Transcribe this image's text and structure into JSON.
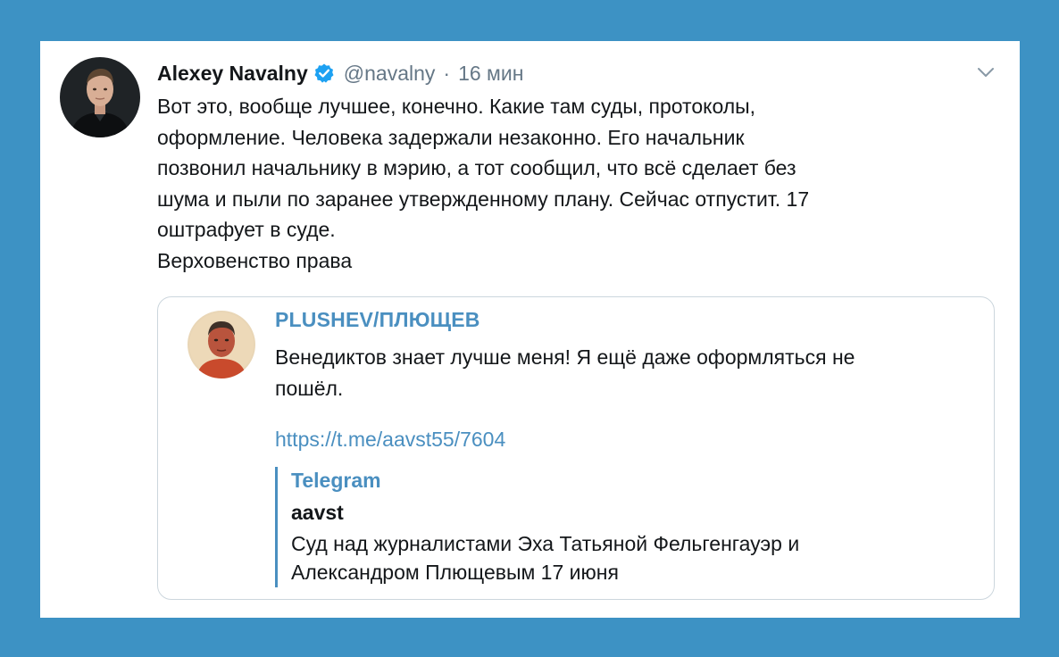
{
  "colors": {
    "background": "#3d92c4",
    "card": "#ffffff",
    "accent": "#4a8fc0",
    "verified": "#1da1f2",
    "muted": "#657786",
    "text": "#14171a"
  },
  "tweet": {
    "author": {
      "name": "Alexey Navalny",
      "handle": "@navalny",
      "verified_icon": "verified-badge-icon",
      "avatar_icon": "profile-avatar"
    },
    "separator": "·",
    "time": "16 мин",
    "menu_icon": "chevron-down-icon",
    "text_lines": [
      "Вот это, вообще лучшее, конечно. Какие там суды, протоколы,",
      "оформление. Человека задержали незаконно. Его начальник",
      "позвонил начальнику в мэрию, а тот сообщил, что всё сделает без",
      "шума и пыли по заранее утвержденному плану. Сейчас отпустит. 17",
      "оштрафует в суде.",
      "Верховенство права"
    ],
    "quote": {
      "channel": "PLUSHEV/ПЛЮЩЕВ",
      "avatar_icon": "channel-avatar",
      "text_lines": [
        "Венедиктов знает лучше меня! Я ещё даже оформляться не",
        "пошёл."
      ],
      "link": "https://t.me/aavst55/7604",
      "preview": {
        "site": "Telegram",
        "title": "aavst",
        "description_lines": [
          "Суд над журналистами Эха Татьяной Фельгенгауэр и",
          "Александром Плющевым 17 июня"
        ]
      }
    }
  }
}
